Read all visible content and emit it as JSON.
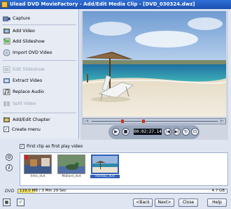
{
  "window": {
    "title": "Ulead DVD MovieFactory - Add/Edit Media Clip - [DVD_030324.dwz]"
  },
  "sidebar": {
    "items": [
      {
        "label": "Capture",
        "icon": "camera-icon",
        "enabled": true
      },
      {
        "label": "Add Video",
        "icon": "film-add-icon",
        "enabled": true
      },
      {
        "label": "Add Slideshow",
        "icon": "slideshow-add-icon",
        "enabled": true
      },
      {
        "label": "Import DVD Video",
        "icon": "dvd-import-icon",
        "enabled": true
      },
      {
        "label": "Edit Slideshow",
        "icon": "slideshow-edit-icon",
        "enabled": false
      },
      {
        "label": "Extract Video",
        "icon": "extract-icon",
        "enabled": true
      },
      {
        "label": "Replace Audio",
        "icon": "audio-icon",
        "enabled": true
      },
      {
        "label": "Split Video",
        "icon": "split-icon",
        "enabled": false
      },
      {
        "label": "Add/Edit Chapter",
        "icon": "chapter-icon",
        "enabled": true
      },
      {
        "label": "Create menu",
        "icon": "checkbox",
        "enabled": true,
        "checked": true
      }
    ]
  },
  "player": {
    "timecode": "00:02:27.14"
  },
  "options": {
    "first_clip_label": "First clip as first play video",
    "first_clip_checked": true
  },
  "clips": [
    {
      "caption": "Intro_dvd",
      "selected": false
    },
    {
      "caption": "Mallard_dvd",
      "selected": false
    },
    {
      "caption": "Holiday_dvd",
      "selected": true
    }
  ],
  "disc": {
    "label": "DVD",
    "usage_text": "119.0 MB / 3 Min 29 Sec",
    "capacity": "4.7 GB",
    "used_fraction": 0.08
  },
  "footer": {
    "back": "<Back",
    "next": "Next>",
    "close": "Close",
    "help": "Help"
  }
}
